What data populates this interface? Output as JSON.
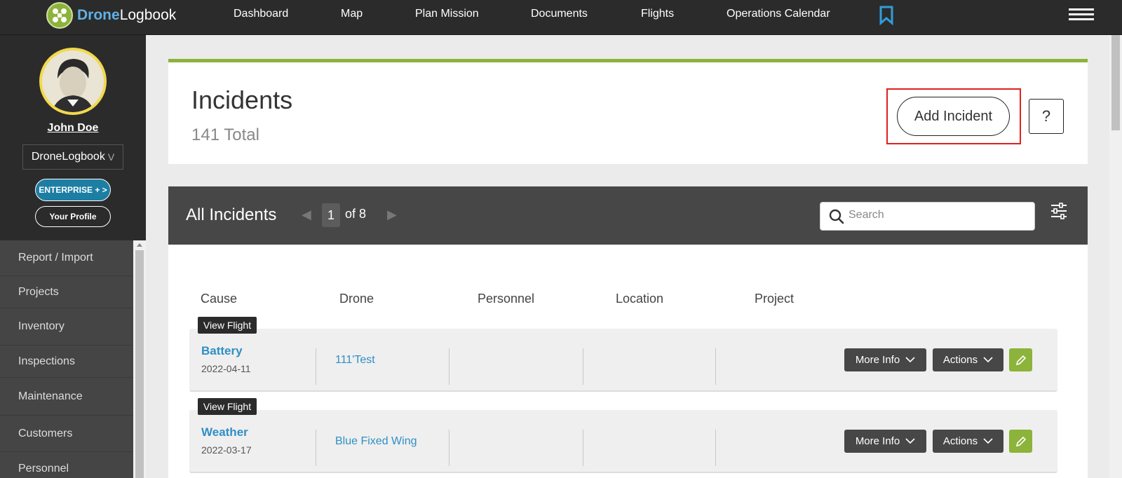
{
  "nav": {
    "logo_brand": "Drone",
    "logo_rest": "Logbook",
    "items": [
      {
        "label": "Dashboard"
      },
      {
        "label": "Map"
      },
      {
        "label": "Plan Mission"
      },
      {
        "label": "Documents"
      },
      {
        "label": "Flights"
      },
      {
        "label": "Operations Calendar"
      }
    ]
  },
  "sidebar": {
    "user_name": "John Doe",
    "org": "DroneLogbook",
    "org_caret": "V",
    "enterprise_label": "ENTERPRISE + >",
    "profile_label": "Your Profile",
    "menu": [
      {
        "label": "Report / Import"
      },
      {
        "label": "Projects"
      },
      {
        "label": "Inventory"
      },
      {
        "label": "Inspections"
      },
      {
        "label": "Maintenance"
      },
      {
        "label": "Customers"
      },
      {
        "label": "Personnel"
      }
    ]
  },
  "header": {
    "title": "Incidents",
    "total": "141 Total",
    "add_label": "Add Incident",
    "help_label": "?"
  },
  "list": {
    "title": "All Incidents",
    "page_current": "1",
    "page_of": "of 8",
    "search_placeholder": "Search",
    "columns": [
      "Cause",
      "Drone",
      "Personnel",
      "Location",
      "Project"
    ],
    "view_flight_label": "View Flight",
    "more_info_label": "More Info",
    "actions_label": "Actions",
    "rows": [
      {
        "cause": "Battery",
        "date": "2022-04-11",
        "drone": "111'Test",
        "personnel": "",
        "location": "",
        "project": ""
      },
      {
        "cause": "Weather",
        "date": "2022-03-17",
        "drone": "Blue Fixed Wing",
        "personnel": "",
        "location": "",
        "project": ""
      }
    ]
  },
  "colors": {
    "accent_green": "#8cb33a",
    "link_blue": "#2f8fc4",
    "highlight_red": "#e0201b",
    "nav_dark": "#2b2b2b"
  }
}
